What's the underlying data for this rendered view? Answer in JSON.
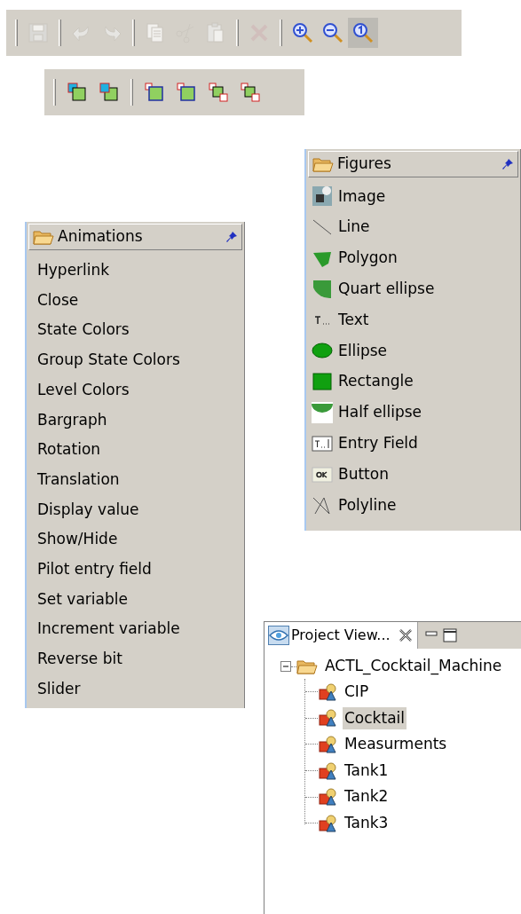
{
  "toolbar_main": {
    "groups": [
      [
        {
          "kind": "save",
          "disabled": true,
          "selected": false
        }
      ],
      [
        {
          "kind": "undo",
          "disabled": true,
          "selected": false
        },
        {
          "kind": "redo",
          "disabled": true,
          "selected": false
        }
      ],
      [
        {
          "kind": "copy",
          "disabled": true,
          "selected": false
        },
        {
          "kind": "cut",
          "disabled": true,
          "selected": false
        },
        {
          "kind": "paste",
          "disabled": true,
          "selected": false
        }
      ],
      [
        {
          "kind": "delete",
          "disabled": true,
          "selected": false
        }
      ],
      [
        {
          "kind": "zoom_in",
          "disabled": false,
          "selected": false
        },
        {
          "kind": "zoom_out",
          "disabled": false,
          "selected": false
        },
        {
          "kind": "zoom_reset",
          "disabled": false,
          "selected": true
        }
      ]
    ]
  },
  "toolbar_layers": {
    "groups": [
      [
        {
          "kind": "bring_front"
        },
        {
          "kind": "send_back"
        }
      ],
      [
        {
          "kind": "forward_a"
        },
        {
          "kind": "forward_b"
        },
        {
          "kind": "backward_a"
        },
        {
          "kind": "backward_b"
        }
      ]
    ]
  },
  "figures_palette": {
    "title": "Figures",
    "items": [
      {
        "kind": "image",
        "label": "Image"
      },
      {
        "kind": "line",
        "label": "Line"
      },
      {
        "kind": "polygon",
        "label": "Polygon"
      },
      {
        "kind": "quart_ellipse",
        "label": "Quart ellipse"
      },
      {
        "kind": "text",
        "label": "Text"
      },
      {
        "kind": "ellipse",
        "label": "Ellipse"
      },
      {
        "kind": "rectangle",
        "label": "Rectangle"
      },
      {
        "kind": "half_ellipse",
        "label": "Half ellipse"
      },
      {
        "kind": "entry_field",
        "label": "Entry Field"
      },
      {
        "kind": "button",
        "label": "Button"
      },
      {
        "kind": "polyline",
        "label": "Polyline"
      }
    ]
  },
  "animations_palette": {
    "title": "Animations",
    "items": [
      "Hyperlink",
      "Close",
      "State Colors",
      "Group State Colors",
      "Level Colors",
      "Bargraph",
      "Rotation",
      "Translation",
      "Display value",
      "Show/Hide",
      "Pilot entry field",
      "Set variable",
      "Increment variable",
      "Reverse bit",
      "Slider"
    ]
  },
  "project_view": {
    "tab_title": "Project View...",
    "tree": [
      {
        "label": "ACTL_Cocktail_Machine",
        "expanded": true,
        "selected": false,
        "children": [
          {
            "label": "CIP",
            "selected": false
          },
          {
            "label": "Cocktail",
            "selected": true
          },
          {
            "label": "Measurments",
            "selected": false
          },
          {
            "label": "Tank1",
            "selected": false
          },
          {
            "label": "Tank2",
            "selected": false
          },
          {
            "label": "Tank3",
            "selected": false
          }
        ]
      }
    ]
  }
}
